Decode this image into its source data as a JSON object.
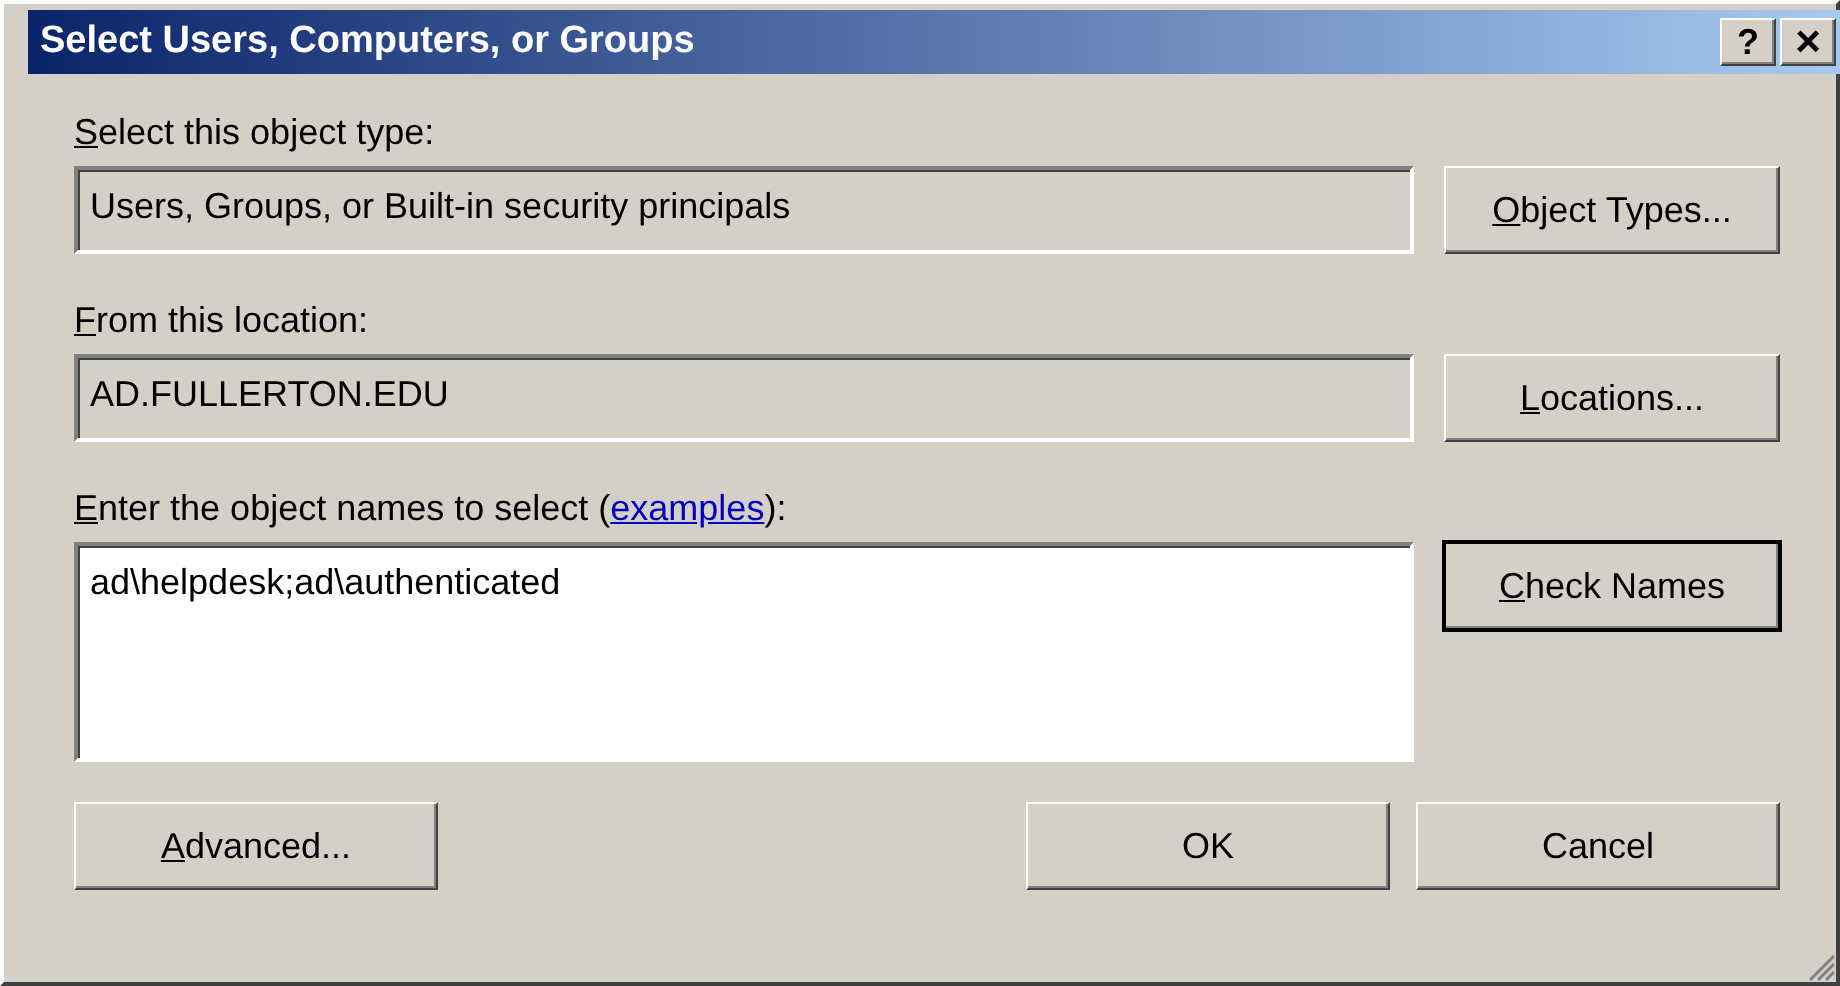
{
  "window": {
    "title": "Select Users, Computers, or Groups",
    "title_buttons": [
      {
        "kind": "help",
        "label": "?"
      },
      {
        "kind": "close",
        "label": "×"
      }
    ]
  },
  "sections": [
    {
      "label": "Select this object type:",
      "mnemonic": true,
      "kind": "readonly",
      "value": "Users, Groups, or Built-in security principals",
      "button": {
        "label": "Object Types...",
        "mnemonic": true,
        "default": false
      }
    },
    {
      "label": "From this location:",
      "mnemonic": true,
      "kind": "readonly",
      "value": "AD.FULLERTON.EDU",
      "button": {
        "label": "Locations...",
        "mnemonic": true,
        "default": false
      }
    },
    {
      "label": "Enter the object names to select (",
      "mnemonic": true,
      "link": "examples",
      "label_end": "):",
      "kind": "editable",
      "value": "ad\\helpdesk;ad\\authenticated",
      "button": {
        "label": "Check Names",
        "mnemonic": true,
        "default": true
      }
    }
  ],
  "footer_left_buttons": [
    {
      "label": "Advanced...",
      "mnemonic": true,
      "default": false
    }
  ],
  "footer_right_buttons": [
    {
      "label": "OK",
      "mnemonic": false,
      "default": false
    },
    {
      "label": "Cancel",
      "mnemonic": false,
      "default": false
    }
  ]
}
